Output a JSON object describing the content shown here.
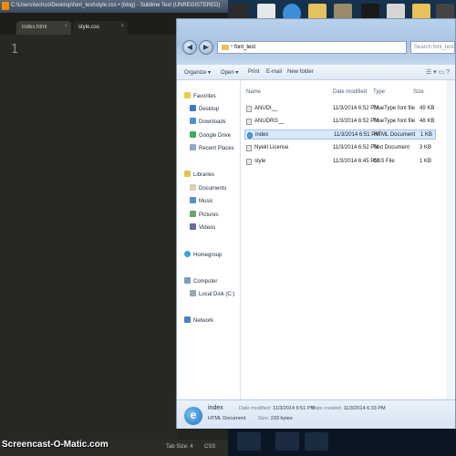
{
  "sublime": {
    "title": "C:\\Users\\techco\\Desktop\\font_test\\style.css • (blog) - Sublime Text (UNREGISTERED)",
    "tabs": [
      {
        "label": "index.html"
      },
      {
        "label": "style.css"
      }
    ],
    "line_number": "1",
    "status": {
      "tab_size": "Tab Size: 4",
      "syntax": "CSS"
    }
  },
  "explorer": {
    "address_path": "font_test",
    "search_placeholder": "Search font_test",
    "toolbar": {
      "organize": "Organize ▾",
      "open": "Open ▾",
      "print": "Print",
      "email": "E-mail",
      "new_folder": "New folder"
    },
    "nav": {
      "favorites": "Favorites",
      "desktop": "Desktop",
      "downloads": "Downloads",
      "google_drive": "Google Drive",
      "recent_places": "Recent Places",
      "libraries": "Libraries",
      "documents": "Documents",
      "music": "Music",
      "pictures": "Pictures",
      "videos": "Videos",
      "homegroup": "Homegroup",
      "computer": "Computer",
      "local_disk": "Local Disk (C:)",
      "network": "Network"
    },
    "columns": {
      "name": "Name",
      "date": "Date modified",
      "type": "Type",
      "size": "Size"
    },
    "files": [
      {
        "name": "ANUDI__",
        "date": "11/3/2014 6:52 PM",
        "type": "TrueType font file",
        "size": "49 KB"
      },
      {
        "name": "ANUDRG__",
        "date": "11/3/2014 6:52 PM",
        "type": "TrueType font file",
        "size": "48 KB"
      },
      {
        "name": "index",
        "date": "11/3/2014 6:51 PM",
        "type": "HTML Document",
        "size": "1 KB"
      },
      {
        "name": "Nyekl License",
        "date": "11/3/2014 6:52 PM",
        "type": "Text Document",
        "size": "3 KB"
      },
      {
        "name": "style",
        "date": "11/3/2014 6:45 PM",
        "type": "CSS File",
        "size": "1 KB"
      }
    ],
    "details": {
      "name": "index",
      "kind": "HTML Document",
      "modified_label": "Date modified:",
      "modified": "11/3/2014 6:51 PM",
      "created_label": "Date created:",
      "created": "11/3/2014 6:33 PM",
      "size_label": "Size:",
      "size": "233 bytes"
    }
  },
  "watermark": "Screencast-O-Matic.com"
}
